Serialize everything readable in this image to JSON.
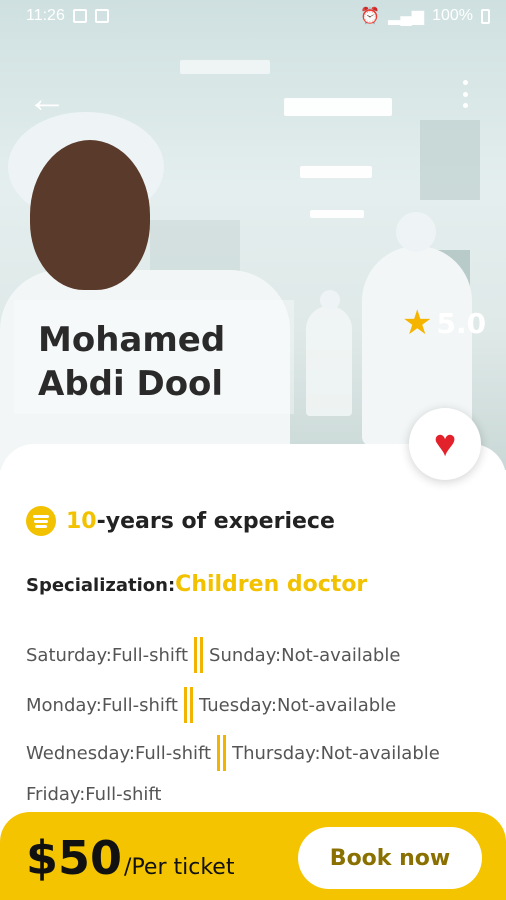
{
  "status_bar": {
    "time": "11:26",
    "battery": "100%",
    "icons": [
      "image-icon",
      "sim-icon",
      "alarm-icon",
      "signal-icon",
      "battery-icon"
    ]
  },
  "header": {
    "back_icon": "arrow-left-icon",
    "menu_icon": "more-vert-icon"
  },
  "doctor": {
    "name": "Mohamed Abdi Dool",
    "rating": "5.0",
    "rating_icon": "star-icon",
    "favorite_icon": "heart-icon"
  },
  "experience": {
    "icon": "spotify-like-icon",
    "years": "10",
    "suffix": "-years of experiece"
  },
  "specialization": {
    "label": "Specialization:",
    "value": "Children doctor"
  },
  "schedule": [
    {
      "left": "Saturday:Full-shift",
      "right": "Sunday:Not-available"
    },
    {
      "left": "Monday:Full-shift",
      "right": "Tuesday:Not-available"
    },
    {
      "left": "Wednesday:Full-shift",
      "right": "Thursday:Not-available"
    },
    {
      "left": "Friday:Full-shift",
      "right": ""
    }
  ],
  "booking": {
    "price": "$50",
    "unit": "/Per ticket",
    "button_label": "Book now"
  },
  "colors": {
    "accent": "#f4c400",
    "heart": "#e3212b",
    "star": "#f5b400"
  }
}
